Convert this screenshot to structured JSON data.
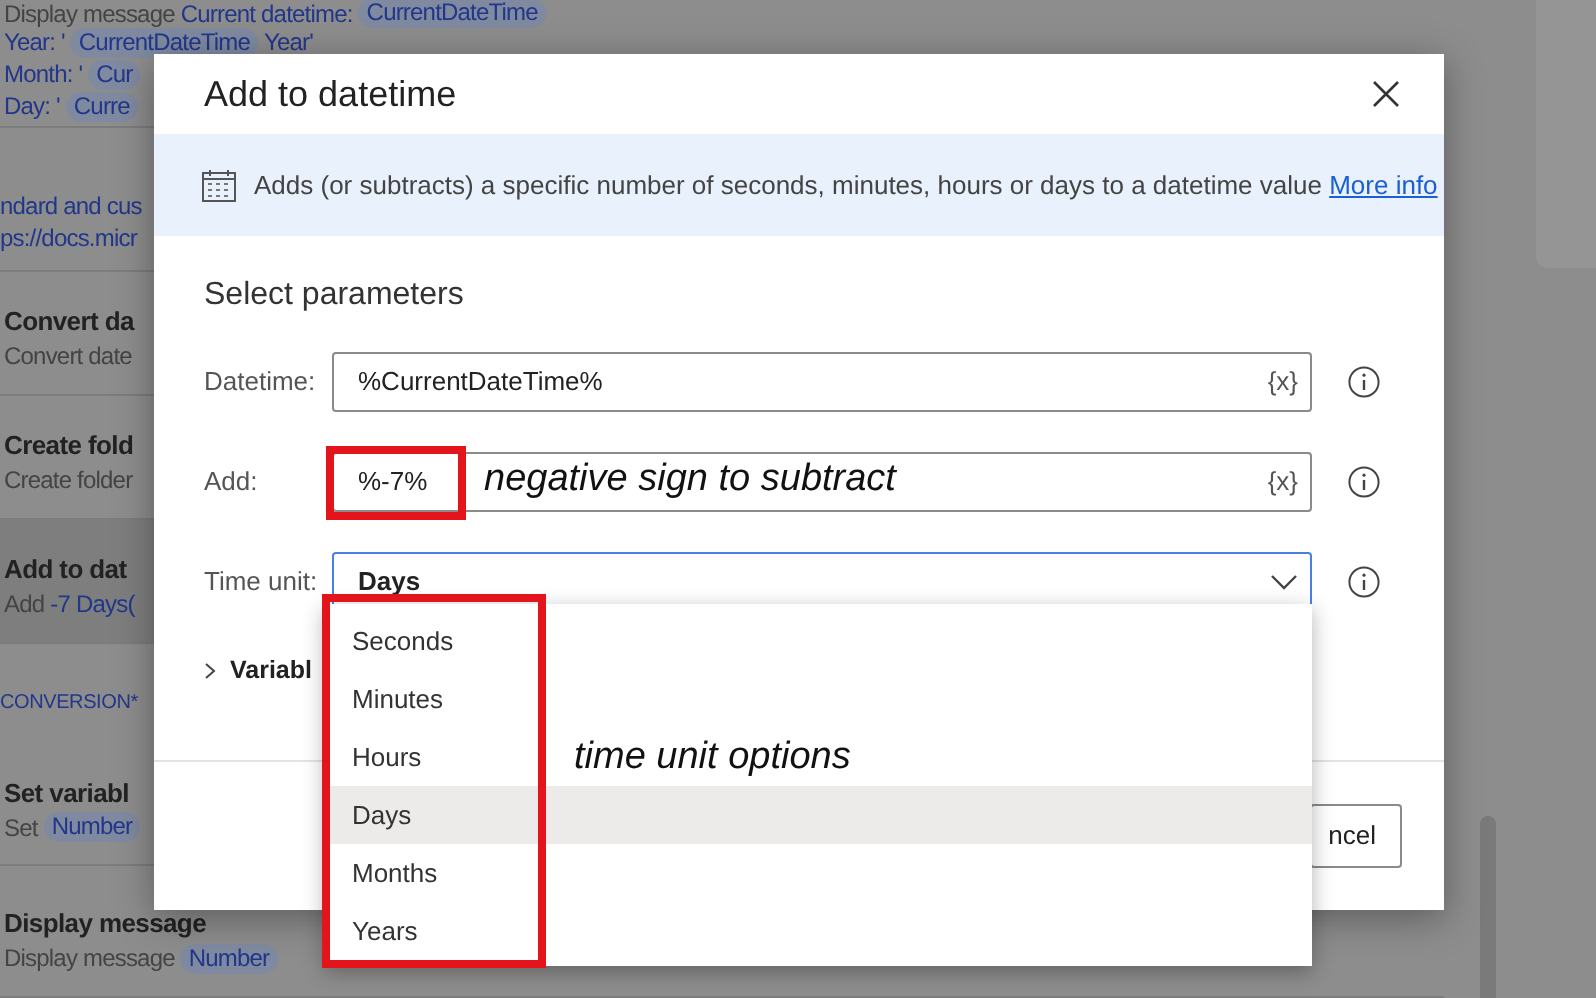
{
  "flow_background": {
    "header_rows": [
      {
        "segments": [
          {
            "kind": "text",
            "text": "Display message"
          },
          {
            "kind": "link",
            "text": "Current datetime:"
          },
          {
            "kind": "tag",
            "text": "CurrentDateTime"
          }
        ]
      },
      {
        "segments": [
          {
            "kind": "link",
            "text": "Year: '"
          },
          {
            "kind": "tag",
            "text": "CurrentDateTime"
          },
          {
            "kind": "link",
            "text": "Year'"
          }
        ]
      },
      {
        "segments": [
          {
            "kind": "link",
            "text": "Month: '"
          },
          {
            "kind": "tag",
            "text": "Cur"
          }
        ]
      },
      {
        "segments": [
          {
            "kind": "link",
            "text": "Day: '"
          },
          {
            "kind": "tag",
            "text": "Curre"
          }
        ]
      }
    ],
    "comment_lines": [
      "ndard and cus",
      "ps://docs.micr"
    ],
    "items": [
      {
        "kind": "action",
        "title": "Convert da",
        "selected": false,
        "details": [
          {
            "kind": "text",
            "text": "Convert date"
          }
        ]
      },
      {
        "kind": "action",
        "title": "Create fold",
        "selected": false,
        "details": [
          {
            "kind": "text",
            "text": "Create folder"
          }
        ]
      },
      {
        "kind": "action",
        "title": "Add to dat",
        "selected": true,
        "details": [
          {
            "kind": "text",
            "text": "Add"
          },
          {
            "kind": "link",
            "text": "-7 Days("
          }
        ]
      },
      {
        "kind": "region",
        "title": "CONVERSION*"
      },
      {
        "kind": "action",
        "title": "Set variabl",
        "selected": false,
        "details": [
          {
            "kind": "text",
            "text": "Set"
          },
          {
            "kind": "tag",
            "text": "Number"
          }
        ]
      },
      {
        "kind": "action",
        "title": "Display message",
        "selected": false,
        "details": [
          {
            "kind": "text",
            "text": "Display message"
          },
          {
            "kind": "tag",
            "text": "Number"
          }
        ]
      }
    ]
  },
  "dialog": {
    "title": "Add to datetime",
    "description": "Adds (or subtracts) a specific number of seconds, minutes, hours or days to a datetime value",
    "more_info": "More info",
    "section": "Select parameters",
    "parameters": [
      {
        "label": "Datetime:",
        "kind": "text",
        "value": "%CurrentDateTime%",
        "variable_button": "{x}"
      },
      {
        "label": "Add:",
        "kind": "text",
        "value": "%-7%",
        "variable_button": "{x}"
      },
      {
        "label": "Time unit:",
        "kind": "select",
        "value": "Days",
        "expanded": true
      }
    ],
    "variables_toggle": {
      "label": "Variabl",
      "expanded": false
    },
    "footer_button": "ncel"
  },
  "dropdown_options": [
    {
      "label": "Seconds",
      "selected": false
    },
    {
      "label": "Minutes",
      "selected": false
    },
    {
      "label": "Hours",
      "selected": false
    },
    {
      "label": "Days",
      "selected": true
    },
    {
      "label": "Months",
      "selected": false
    },
    {
      "label": "Years",
      "selected": false
    }
  ],
  "annotations": [
    {
      "kind": "field",
      "text": "negative sign to subtract"
    },
    {
      "kind": "list",
      "text": "time unit options"
    }
  ]
}
